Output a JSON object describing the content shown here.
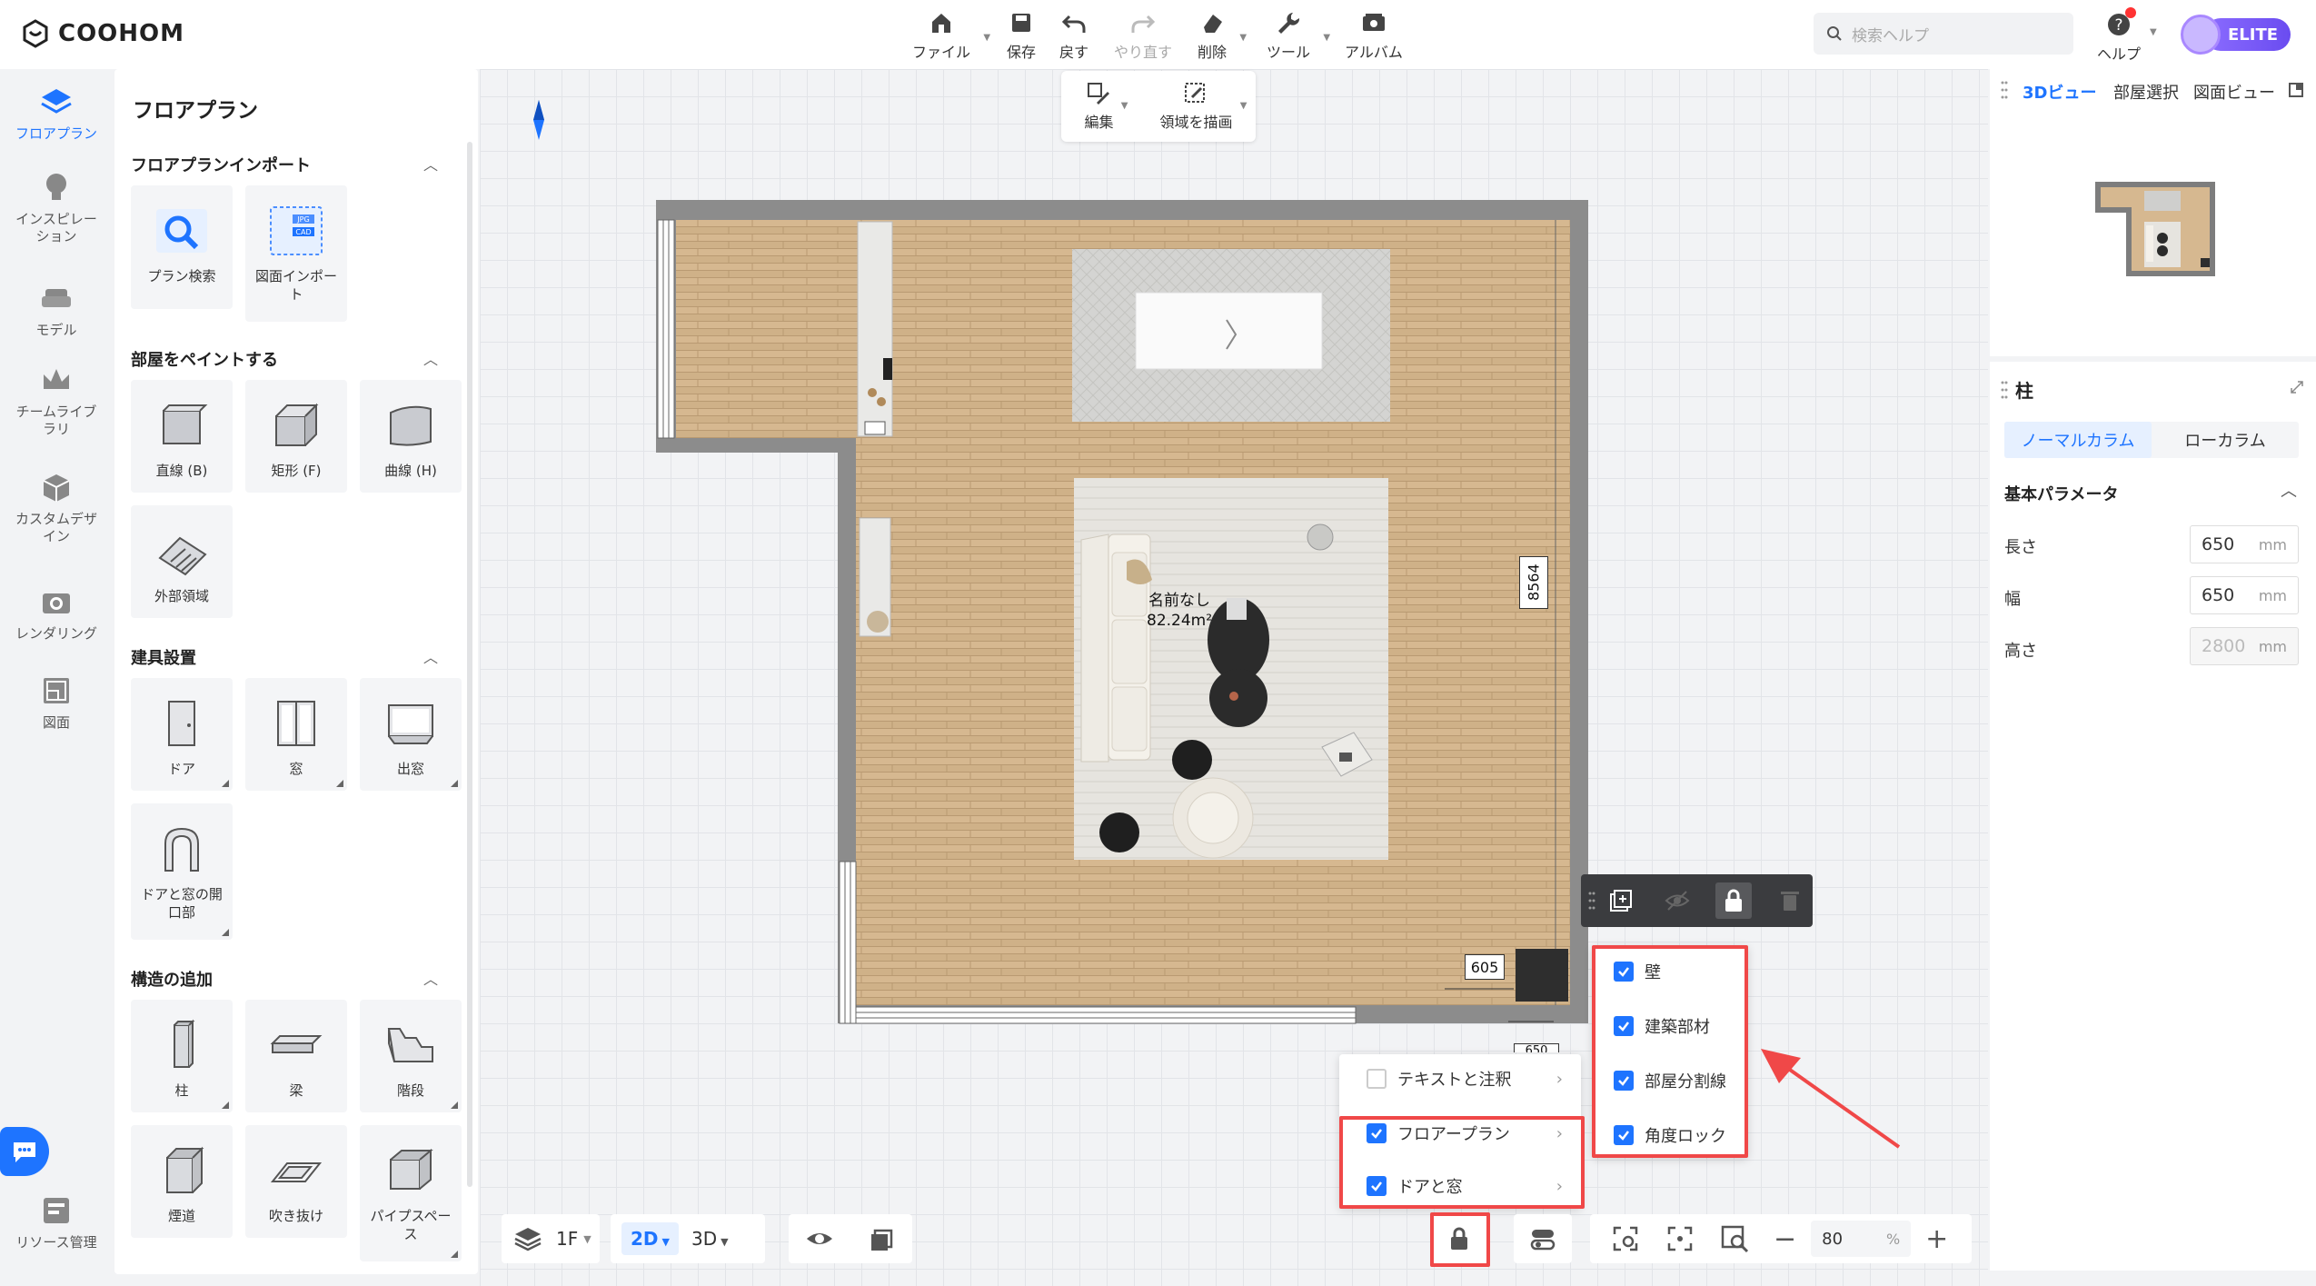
{
  "app": {
    "brand": "COOHOM"
  },
  "toolbar": {
    "file": "ファイル",
    "save": "保存",
    "undo": "戻す",
    "redo": "やり直す",
    "delete": "削除",
    "tools": "ツール",
    "album": "アルバム"
  },
  "search": {
    "placeholder": "検索ヘルプ"
  },
  "help": {
    "label": "ヘルプ"
  },
  "account": {
    "tier": "ELITE"
  },
  "leftnav": {
    "floorplan": "フロアプラン",
    "inspiration": "インスピレーション",
    "model": "モデル",
    "team_library": "チームライブラリ",
    "custom_design": "カスタムデザイン",
    "rendering": "レンダリング",
    "drawing": "図面",
    "resource": "リソース管理"
  },
  "panel": {
    "title": "フロアプラン",
    "import_section": "フロアプランインポート",
    "import_items": [
      "プラン検索",
      "図面インポート"
    ],
    "paint_section": "部屋をペイントする",
    "paint_items": [
      "直線 (B)",
      "矩形 (F)",
      "曲線 (H)",
      "外部領域"
    ],
    "fixture_section": "建具設置",
    "fixture_items": [
      "ドア",
      "窓",
      "出窓",
      "ドアと窓の開口部"
    ],
    "structure_section": "構造の追加",
    "structure_items": [
      "柱",
      "梁",
      "階段",
      "煙道",
      "吹き抜け",
      "パイプスペース"
    ]
  },
  "draw_toolbar": {
    "edit": "編集",
    "draw_area": "領域を描画"
  },
  "plan": {
    "room_name": "名前なし",
    "room_area": "82.24m²",
    "dim_height": "8564",
    "dim_column": "605",
    "dim_bottom": "650"
  },
  "lock_menu_left": [
    {
      "label": "テキストと注釈",
      "checked": false
    },
    {
      "label": "フロアープラン",
      "checked": true
    },
    {
      "label": "ドアと窓",
      "checked": true
    }
  ],
  "lock_menu_right": [
    {
      "label": "壁",
      "checked": true
    },
    {
      "label": "建築部材",
      "checked": true
    },
    {
      "label": "部屋分割線",
      "checked": true
    },
    {
      "label": "角度ロック",
      "checked": true
    }
  ],
  "bottombar": {
    "floor": "1F",
    "mode_2d": "2D",
    "mode_3d": "3D",
    "zoom": "80",
    "zoom_unit": "%"
  },
  "right_panel": {
    "tabs": [
      "3Dビュー",
      "部屋選択",
      "図面ビュー"
    ],
    "prop_title": "柱",
    "column_types": [
      "ノーマルカラム",
      "ローカラム"
    ],
    "params_title": "基本パラメータ",
    "params": [
      {
        "label": "長さ",
        "value": "650",
        "unit": "mm",
        "disabled": false
      },
      {
        "label": "幅",
        "value": "650",
        "unit": "mm",
        "disabled": false
      },
      {
        "label": "高さ",
        "value": "2800",
        "unit": "mm",
        "disabled": true
      }
    ]
  },
  "colors": {
    "accent": "#1e74ff",
    "highlight": "#f04848",
    "wall": "#8a8a8a",
    "floor": "#d2b48c"
  }
}
